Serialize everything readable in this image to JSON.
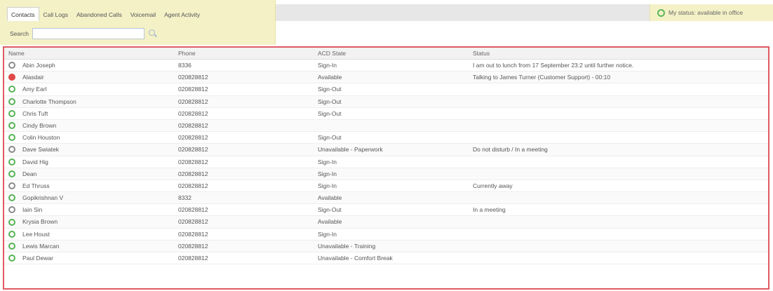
{
  "tabs": [
    {
      "label": "Contacts",
      "active": true
    },
    {
      "label": "Call Logs",
      "active": false
    },
    {
      "label": "Abandoned Calls",
      "active": false
    },
    {
      "label": "Voicemail",
      "active": false
    },
    {
      "label": "Agent Activity",
      "active": false
    }
  ],
  "search": {
    "label": "Search",
    "value": ""
  },
  "my_status": {
    "text": "My status: available in office",
    "icon": "available-status-icon",
    "color": "#5cb85c"
  },
  "columns": {
    "name": "Name",
    "phone": "Phone",
    "acd": "ACD State",
    "status": "Status"
  },
  "presence_colors": {
    "available": "#56b356",
    "offline": "#8a8a8a",
    "busy": "#e04848"
  },
  "rows": [
    {
      "presence": "offline",
      "name": "Abin Joseph",
      "phone": "8336",
      "acd": "Sign-In",
      "status": "I am out to lunch from 17 September 23:2 until further notice."
    },
    {
      "presence": "busy",
      "name": "Alasdair",
      "phone": "020828812",
      "acd": "Available",
      "status": "Talking to James Turner (Customer Support) - 00:10"
    },
    {
      "presence": "available",
      "name": "Amy Earl",
      "phone": "020828812",
      "acd": "Sign-Out",
      "status": ""
    },
    {
      "presence": "available",
      "name": "Charlotte Thompson",
      "phone": "020828812",
      "acd": "Sign-Out",
      "status": ""
    },
    {
      "presence": "available",
      "name": "Chris Tuft",
      "phone": "020828812",
      "acd": "Sign-Out",
      "status": ""
    },
    {
      "presence": "available",
      "name": "Cindy Brown",
      "phone": "020828812",
      "acd": "",
      "status": ""
    },
    {
      "presence": "available",
      "name": "Colin Houston",
      "phone": "020828812",
      "acd": "Sign-Out",
      "status": ""
    },
    {
      "presence": "offline",
      "name": "Dave Swiatek",
      "phone": "020828812",
      "acd": "Unavailable - Paperwork",
      "status": "Do not disturb / In a meeting"
    },
    {
      "presence": "available",
      "name": "David Hig",
      "phone": "020828812",
      "acd": "Sign-In",
      "status": ""
    },
    {
      "presence": "available",
      "name": "Dean",
      "phone": "020828812",
      "acd": "Sign-In",
      "status": ""
    },
    {
      "presence": "offline",
      "name": "Ed Thruss",
      "phone": "020828812",
      "acd": "Sign-In",
      "status": "Currently away"
    },
    {
      "presence": "available",
      "name": "Gopikrishnan V",
      "phone": "8332",
      "acd": "Available",
      "status": ""
    },
    {
      "presence": "offline",
      "name": "Iain Sin",
      "phone": "020828812",
      "acd": "Sign-Out",
      "status": "In a meeting"
    },
    {
      "presence": "available",
      "name": "Krysia Brown",
      "phone": "020828812",
      "acd": "Available",
      "status": ""
    },
    {
      "presence": "available",
      "name": "Lee Houst",
      "phone": "020828812",
      "acd": "Sign-In",
      "status": ""
    },
    {
      "presence": "available",
      "name": "Lewis Marcan",
      "phone": "020828812",
      "acd": "Unavailable - Training",
      "status": ""
    },
    {
      "presence": "available",
      "name": "Paul Dewar",
      "phone": "020828812",
      "acd": "Unavailable - Comfort Break",
      "status": ""
    }
  ]
}
